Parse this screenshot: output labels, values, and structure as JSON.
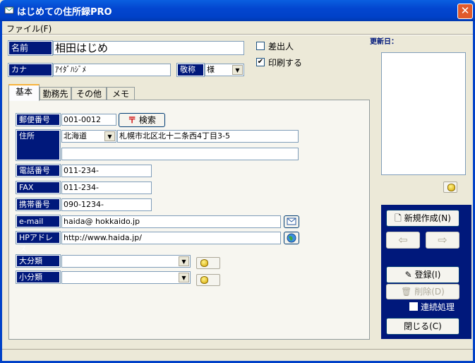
{
  "window": {
    "title": "はじめての住所録PRO",
    "close_glyph": "✕"
  },
  "menu": {
    "file": "ファイル(F)"
  },
  "updated_label": "更新日：",
  "name": {
    "label": "名前",
    "value": "相田はじめ"
  },
  "kana": {
    "label": "カナ",
    "value": "ｱｲﾀﾞﾊｼﾞﾒ"
  },
  "honorific": {
    "label": "敬称",
    "value": "様"
  },
  "checks": {
    "sender": {
      "label": "差出人",
      "checked": false
    },
    "print": {
      "label": "印刷する",
      "checked": true,
      "mark": "✔"
    }
  },
  "tabs": [
    {
      "label": "基本",
      "active": true
    },
    {
      "label": "勤務先",
      "active": false
    },
    {
      "label": "その他",
      "active": false
    },
    {
      "label": "メモ",
      "active": false
    }
  ],
  "basic": {
    "postal": {
      "label": "郵便番号",
      "value": "001-0012",
      "search_button": "検索"
    },
    "address": {
      "label": "住所",
      "prefecture": "北海道",
      "line1": "札幌市北区北十二条西4丁目3-5",
      "line2": ""
    },
    "phone": {
      "label": "電話番号",
      "value": "011-234-"
    },
    "fax": {
      "label": "FAX",
      "value": "011-234-"
    },
    "mobile": {
      "label": "携帯番号",
      "value": "090-1234-"
    },
    "email": {
      "label": "e-mail",
      "value": "haida@          hokkaido.jp"
    },
    "homepage": {
      "label": "HPアドレス",
      "value": "http://www.haida.jp/"
    },
    "major_category": {
      "label": "大分類",
      "value": ""
    },
    "minor_category": {
      "label": "小分類",
      "value": ""
    }
  },
  "actions": {
    "new": "新規作成(N)",
    "prev_glyph": "⇦",
    "next_glyph": "⇨",
    "register": "登録(I)",
    "delete": "削除(D)",
    "continuous": "連続処理",
    "close": "閉じる(C)"
  },
  "colors": {
    "titlebar": "#0046D5",
    "label_bg": "#00187B",
    "panel_bg": "#ECE9D8"
  }
}
